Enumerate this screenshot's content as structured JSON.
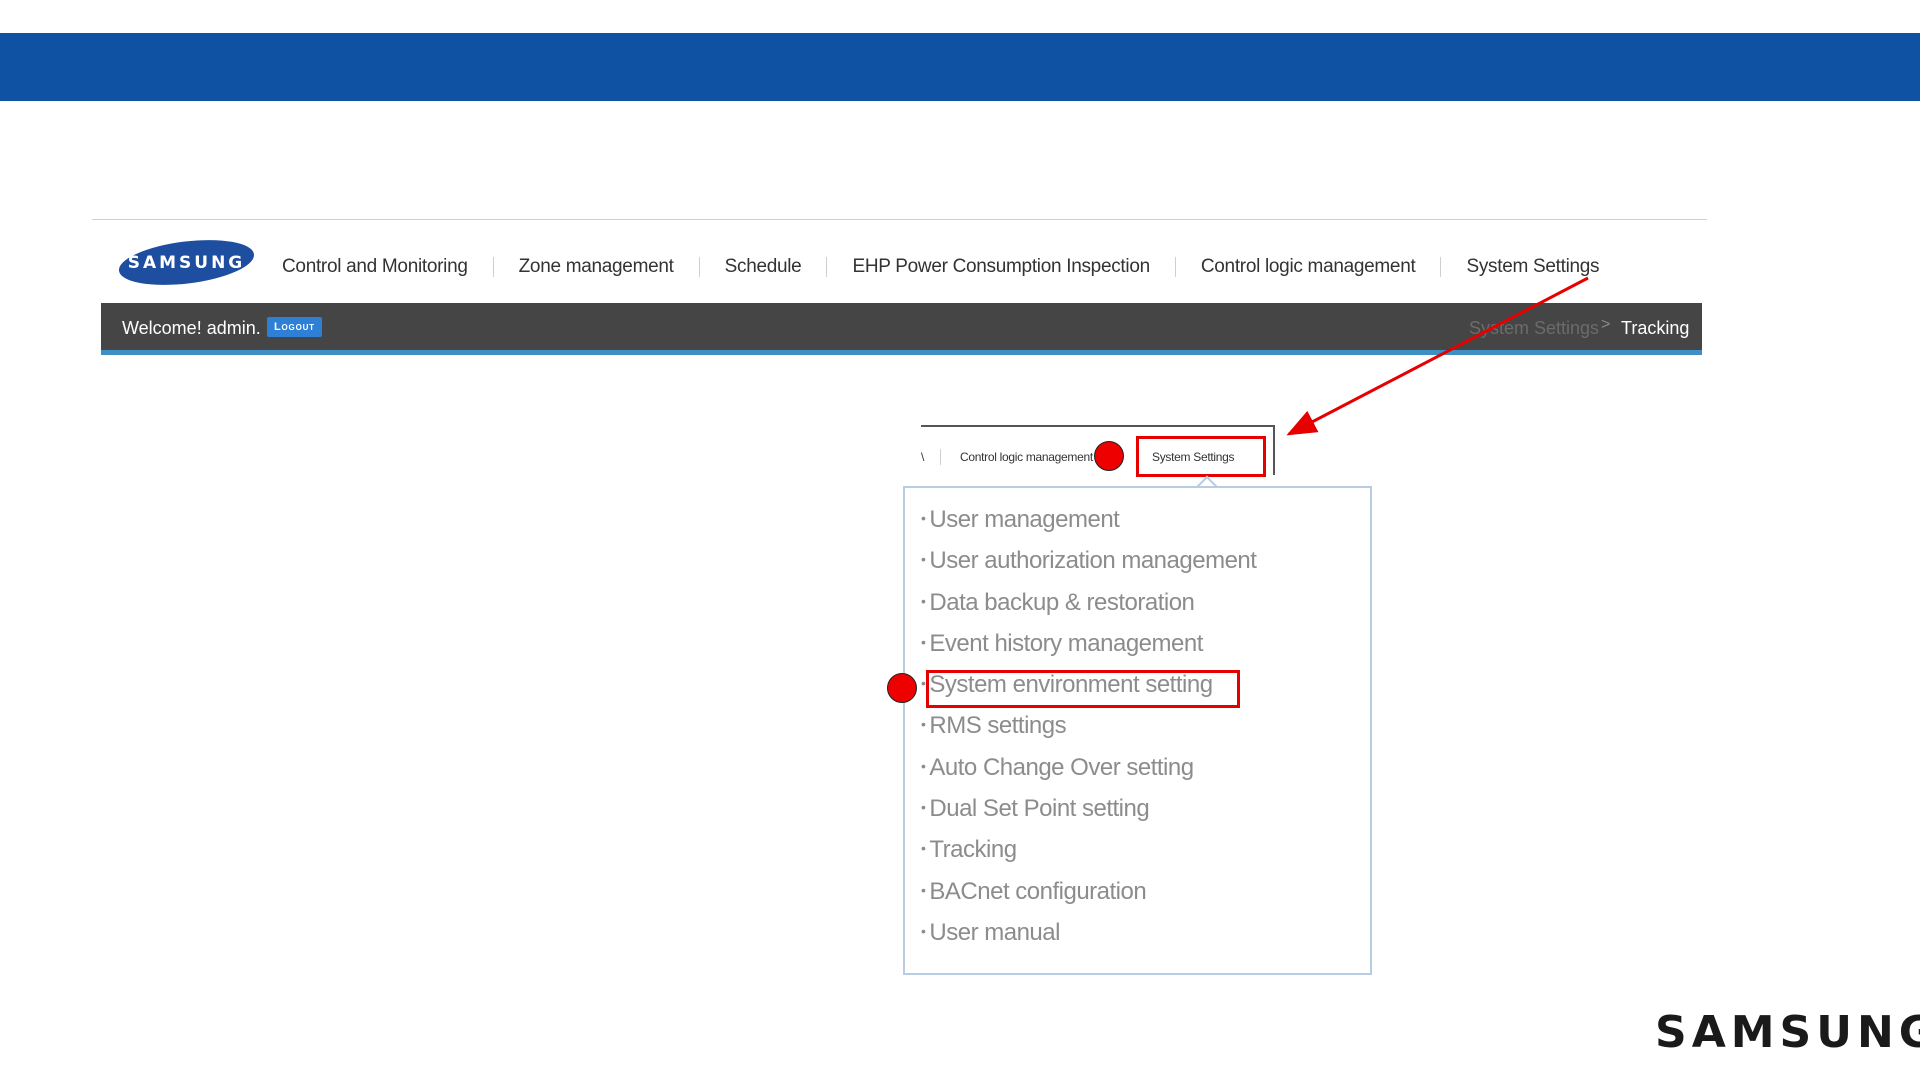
{
  "header": {
    "logo_text": "SAMSUNG",
    "band_color": "#0f52a4"
  },
  "nav": {
    "items": [
      {
        "label": "Control and Monitoring"
      },
      {
        "label": "Zone management"
      },
      {
        "label": "Schedule"
      },
      {
        "label": "EHP Power Consumption Inspection"
      },
      {
        "label": "Control logic management"
      },
      {
        "label": "System Settings"
      }
    ]
  },
  "welcome_bar": {
    "welcome": "Welcome! admin.",
    "logout_label": "Logout",
    "breadcrumb": {
      "parent": "System Settings",
      "separator": ">",
      "current": "Tracking"
    }
  },
  "zoom_tabs": {
    "fragment": "\\",
    "clm": "Control logic management",
    "ss": "System Settings"
  },
  "dropdown": {
    "bullet": "•",
    "items": [
      {
        "label": "User management"
      },
      {
        "label": "User authorization management"
      },
      {
        "label": "Data backup & restoration"
      },
      {
        "label": "Event history management"
      },
      {
        "label": "System environment setting"
      },
      {
        "label": "RMS settings"
      },
      {
        "label": "Auto Change Over setting"
      },
      {
        "label": "Dual Set Point setting"
      },
      {
        "label": "Tracking"
      },
      {
        "label": "BACnet configuration"
      },
      {
        "label": "User manual"
      }
    ]
  },
  "footer": {
    "brand": "SAMSUNG"
  },
  "colors": {
    "accent_blue": "#0f52a4",
    "highlight_red": "#e60000",
    "bar_dark": "#454545",
    "bar_underline": "#3d8fc4"
  }
}
